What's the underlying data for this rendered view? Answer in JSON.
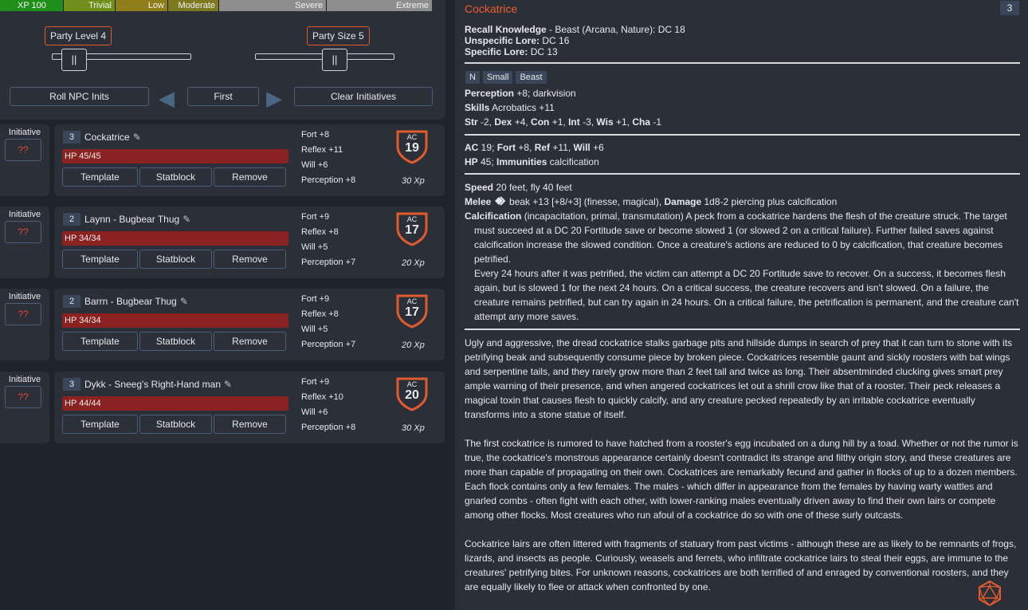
{
  "encounter": {
    "xp_segments": [
      {
        "id": "xp",
        "label": "XP 100"
      },
      {
        "id": "trivial",
        "label": "Trivial"
      },
      {
        "id": "low",
        "label": "Low"
      },
      {
        "id": "moderate",
        "label": "Moderate"
      },
      {
        "id": "severe",
        "label": "Severe"
      },
      {
        "id": "extreme",
        "label": "Extreme"
      }
    ],
    "party_level_label": "Party Level 4",
    "party_size_label": "Party Size 5",
    "party_level_value": 4,
    "party_size_value": 5,
    "slider_handle_glyph": "||",
    "buttons": {
      "roll_npc": "Roll NPC Inits",
      "first": "First",
      "clear": "Clear Initiatives"
    },
    "arrows": {
      "left": "◀",
      "right": "▶"
    }
  },
  "combatants": [
    {
      "initiative_label": "Initiative",
      "initiative": "??",
      "level": "3",
      "name": "Cockatrice",
      "hp": "HP 45/45",
      "fort": "Fort +8",
      "reflex": "Reflex +11",
      "will": "Will +6",
      "perception": "Perception +8",
      "ac_label": "AC",
      "ac": "19",
      "xp": "30 Xp"
    },
    {
      "initiative_label": "Initiative",
      "initiative": "??",
      "level": "2",
      "name": "Laynn - Bugbear Thug",
      "hp": "HP 34/34",
      "fort": "Fort +9",
      "reflex": "Reflex +8",
      "will": "Will +5",
      "perception": "Perception +7",
      "ac_label": "AC",
      "ac": "17",
      "xp": "20 Xp"
    },
    {
      "initiative_label": "Initiative",
      "initiative": "??",
      "level": "2",
      "name": "Barrn - Bugbear Thug",
      "hp": "HP 34/34",
      "fort": "Fort +9",
      "reflex": "Reflex +8",
      "will": "Will +5",
      "perception": "Perception +7",
      "ac_label": "AC",
      "ac": "17",
      "xp": "20 Xp"
    },
    {
      "initiative_label": "Initiative",
      "initiative": "??",
      "level": "3",
      "name": "Dykk - Sneeg's Right-Hand man",
      "hp": "HP 44/44",
      "fort": "Fort +9",
      "reflex": "Reflex +10",
      "will": "Will +6",
      "perception": "Perception +8",
      "ac_label": "AC",
      "ac": "20",
      "xp": "30 Xp"
    }
  ],
  "card_buttons": {
    "template": "Template",
    "statblock": "Statblock",
    "remove": "Remove"
  },
  "statblock": {
    "title": "Cockatrice",
    "level": "3",
    "recall_label": "Recall Knowledge",
    "recall_value": " - Beast (Arcana, Nature): DC 18",
    "unspecific_label": "Unspecific Lore:",
    "unspecific_value": " DC 16",
    "specific_label": "Specific Lore:",
    "specific_value": " DC 13",
    "traits": [
      "N",
      "Small",
      "Beast"
    ],
    "perception_label": "Perception",
    "perception_value": " +8; darkvision",
    "skills_label": "Skills",
    "skills_value": " Acrobatics +11",
    "str_label": "Str",
    "str_value": " -2, ",
    "dex_label": "Dex",
    "dex_value": " +4, ",
    "con_label": "Con",
    "con_value": " +1, ",
    "int_label": "Int",
    "int_value": " -3, ",
    "wis_label": "Wis",
    "wis_value": " +1, ",
    "cha_label": "Cha",
    "cha_value": " -1",
    "ac_label": "AC",
    "ac_value": " 19; ",
    "fort_label": "Fort",
    "fort_value": " +8, ",
    "ref_label": "Ref",
    "ref_value": " +11, ",
    "will_label": "Will",
    "will_value": " +6",
    "hp_label": "HP",
    "hp_value": " 45; ",
    "immunities_label": "Immunities",
    "immunities_value": " calcification",
    "speed_label": "Speed",
    "speed_value": " 20 feet, fly 40 feet",
    "melee_label": "Melee",
    "melee_value": " beak +13 [+8/+3] (finesse, magical), ",
    "damage_label": "Damage",
    "damage_value": " 1d8-2 piercing plus calcification",
    "calc_label": "Calcification",
    "calc_text": " (incapacitation, primal, transmutation) A peck from a cockatrice hardens the flesh of the creature struck. The target must succeed at a DC 20 Fortitude save or become slowed 1 (or slowed 2 on a critical failure). Further failed saves against calcification increase the slowed condition. Once a creature's actions are reduced to 0 by calcification, that creature becomes petrified.",
    "calc_text2": "Every 24 hours after it was petrified, the victim can attempt a DC 20 Fortitude save to recover. On a success, it becomes flesh again, but is slowed 1 for the next 24 hours. On a critical success, the creature recovers and isn't slowed. On a failure, the creature remains petrified, but can try again in 24 hours. On a critical failure, the petrification is permanent, and the creature can't attempt any more saves.",
    "lore_paragraphs": [
      "Ugly and aggressive, the dread cockatrice stalks garbage pits and hillside dumps in search of prey that it can turn to stone with its petrifying beak and subsequently consume piece by broken piece. Cockatrices resemble gaunt and sickly roosters with bat wings and serpentine tails, and they rarely grow more than 2 feet tall and twice as long. Their absentminded clucking gives smart prey ample warning of their presence, and when angered cockatrices let out a shrill crow like that of a rooster. Their peck releases a magical toxin that causes flesh to quickly calcify, and any creature pecked repeatedly by an irritable cockatrice eventually transforms into a stone statue of itself.",
      "The first cockatrice is rumored to have hatched from a rooster's egg incubated on a dung hill by a toad. Whether or not the rumor is true, the cockatrice's monstrous appearance certainly doesn't contradict its strange and filthy origin story, and these creatures are more than capable of propagating on their own. Cockatrices are remarkably fecund and gather in flocks of up to a dozen members. Each flock contains only a few females. The males - which differ in appearance from the females by having warty wattles and gnarled combs - often fight with each other, with lower-ranking males eventually driven away to find their own lairs or compete among other flocks. Most creatures who run afoul of a cockatrice do so with one of these surly outcasts.",
      "Cockatrice lairs are often littered with fragments of statuary from past victims - although these are as likely to be remnants of frogs, lizards, and insects as people. Curiously, weasels and ferrets, who infiltrate cockatrice lairs to steal their eggs, are immune to the creatures' petrifying bites. For unknown reasons, cockatrices are both terrified of and enraged by conventional roosters, and they are equally likely to flee or attack when confronted by one."
    ]
  },
  "colors": {
    "accent": "#ef5b2e",
    "hp_bar": "#8a2222",
    "panel": "#2a2f38",
    "background": "#1f232b",
    "badge": "#3a475a"
  },
  "icons": [
    "pencil-icon",
    "shield-icon",
    "action-icon",
    "d20-icon",
    "arrow-left-icon",
    "arrow-right-icon"
  ]
}
